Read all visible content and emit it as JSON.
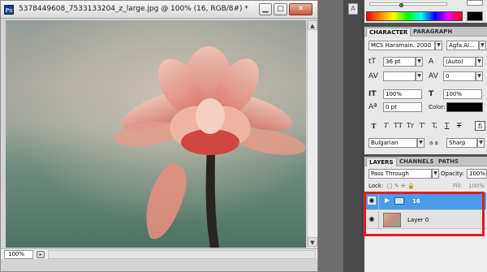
{
  "document": {
    "title": "5378449608_7533133204_z_large.jpg @ 100% (16, RGB/8#) *",
    "app_icon_text": "Ps",
    "zoom": "100%",
    "buttons": {
      "minimize": "▁",
      "maximize": "□",
      "close": "✕"
    },
    "scroll": {
      "up": "▲",
      "down": "▼"
    },
    "status_icon": "▸"
  },
  "colors": {
    "accent": "#4a9be8",
    "highlight_box": "#e21b23",
    "close_button": "#c8563d"
  },
  "icons": {
    "ps": "photoshop-logo",
    "strip": "text-tool-icon",
    "eye": "eye-icon",
    "folder": "folder-icon",
    "lock": "lock-icon"
  },
  "character_panel": {
    "tabs": [
      "CHARACTER",
      "PARAGRAPH"
    ],
    "active_tab": "CHARACTER",
    "font_family": "MCS Haramain. 2000",
    "font_style": "Agfa Al...",
    "font_size": "36 pt",
    "leading": "(Auto)",
    "kerning": "",
    "tracking": "0",
    "vertical_scale": "100%",
    "horizontal_scale": "100%",
    "baseline_shift": "0 pt",
    "color_label": "Color:",
    "type_buttons": [
      "T",
      "T",
      "TT",
      "Tr",
      "T'",
      "T,",
      "T",
      "T"
    ],
    "ligature_button": "fi",
    "language": "Bulgarian",
    "antialias_label": "a a",
    "antialias": "Sharp"
  },
  "layers_panel": {
    "tabs": [
      "LAYERS",
      "CHANNELS",
      "PATHS"
    ],
    "active_tab": "LAYERS",
    "blend_mode": "Pass Through",
    "opacity_label": "Opacity:",
    "opacity": "100%",
    "lock_label": "Lock:",
    "fill_label": "Fill:",
    "fill": "100%",
    "layers": [
      {
        "name": "16",
        "type": "group",
        "selected": true
      },
      {
        "name": "Layer 0",
        "type": "image",
        "selected": false
      }
    ]
  }
}
